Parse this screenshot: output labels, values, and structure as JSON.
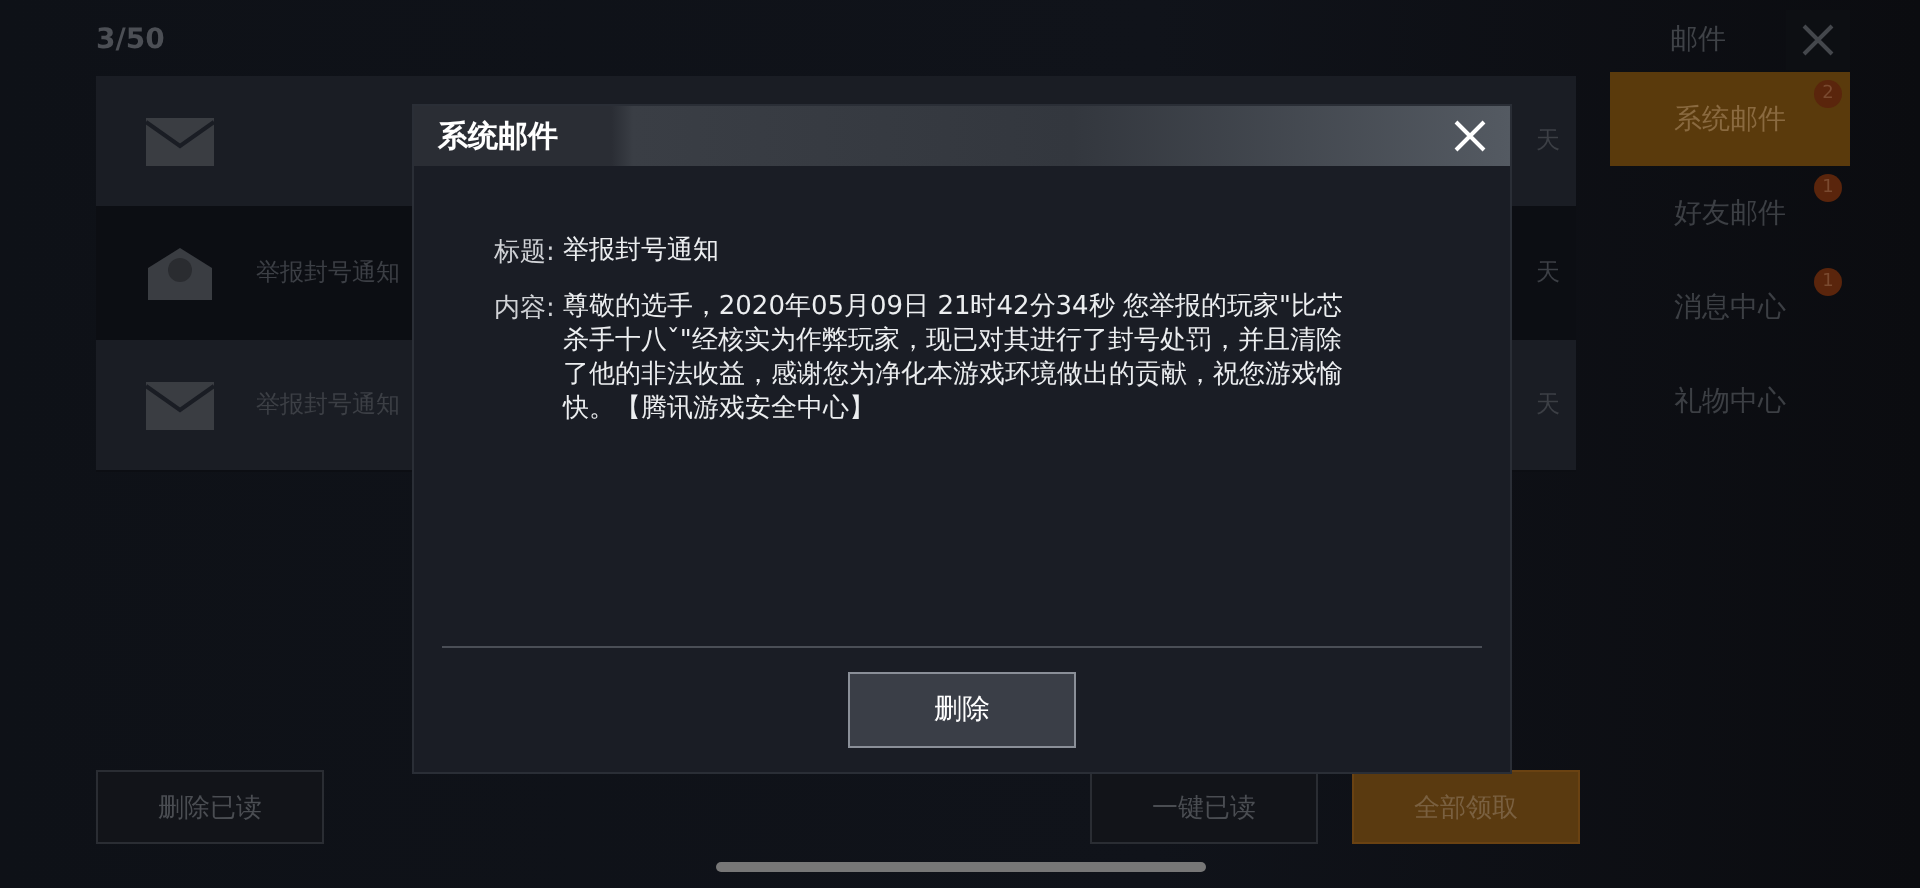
{
  "mail_list": {
    "count": "3/50",
    "items": [
      {
        "selected": false,
        "kind": "closed",
        "days": "天"
      },
      {
        "title": "举报封号通知",
        "selected": true,
        "kind": "opened",
        "days": "天"
      },
      {
        "title": "举报封号通知",
        "selected": false,
        "kind": "closed",
        "days": "天"
      }
    ]
  },
  "sidebar": {
    "title": "邮件",
    "items": [
      {
        "label": "系统邮件",
        "selected": true,
        "badge": "2"
      },
      {
        "label": "好友邮件",
        "selected": false,
        "badge": "1"
      },
      {
        "label": "消息中心",
        "selected": false,
        "badge": "1"
      },
      {
        "label": "礼物中心",
        "selected": false
      }
    ]
  },
  "bottom_buttons": [
    {
      "label": "删除已读",
      "kind": "plain"
    },
    {
      "label": "一键已读",
      "kind": "plain"
    },
    {
      "label": "全部领取",
      "kind": "primary"
    }
  ],
  "dialog": {
    "title": "系统邮件",
    "subject_label": "标题:",
    "subject": "举报封号通知",
    "content_label": "内容:",
    "content": "尊敬的选手，2020年05月09日 21时42分34秒 您举报的玩家\"比芯杀手十八ˇ\"经核实为作弊玩家，现已对其进行了封号处罚，并且清除了他的非法收益，感谢您为净化本游戏环境做出的贡献，祝您游戏愉快。【腾讯游戏安全中心】",
    "button": "删除"
  }
}
